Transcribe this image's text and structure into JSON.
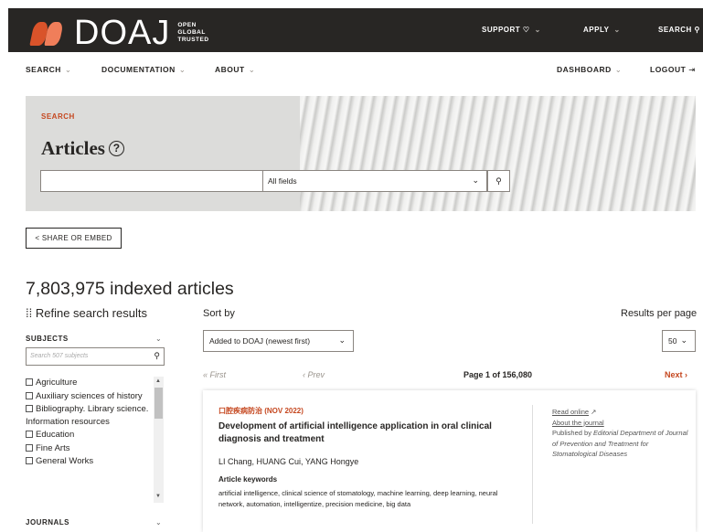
{
  "header": {
    "logo_text": "DOAJ",
    "tagline": [
      "OPEN",
      "GLOBAL",
      "TRUSTED"
    ],
    "support_label": "SUPPORT",
    "apply_label": "APPLY",
    "search_label": "SEARCH"
  },
  "subnav": {
    "search": "SEARCH",
    "documentation": "DOCUMENTATION",
    "about": "ABOUT",
    "dashboard": "DASHBOARD",
    "logout": "LOGOUT"
  },
  "hero": {
    "eyebrow": "SEARCH",
    "title": "Articles",
    "help_glyph": "?",
    "search_value": "",
    "field_select": "All fields",
    "search_button_glyph": "⚲"
  },
  "share_label": "SHARE OR EMBED",
  "results": {
    "count_text": "7,803,975 indexed articles",
    "refine_label": "Refine search results",
    "sort_by_label": "Sort by",
    "sort_value": "Added to DOAJ (newest first)",
    "per_page_label": "Results per page",
    "per_page_value": "50"
  },
  "sidebar": {
    "subjects_heading": "SUBJECTS",
    "subjects_placeholder": "Search 507 subjects",
    "subjects": [
      "Agriculture",
      "Auxiliary sciences of history",
      "Bibliography. Library science. Information resources",
      "Education",
      "Fine Arts",
      "General Works"
    ],
    "journals_heading": "JOURNALS"
  },
  "pager": {
    "first": "« First",
    "prev": "‹ Prev",
    "page_info": "Page 1 of 156,080",
    "next": "Next ›"
  },
  "article": {
    "journal_line": "口腔疾病防治 (NOV 2022)",
    "title": "Development of artificial intelligence application in oral clinical diagnosis and treatment",
    "authors": "LI Chang, HUANG Cui, YANG Hongye",
    "keywords_heading": "Article keywords",
    "keywords": "artificial intelligence, clinical science of stomatology, machine learning, deep learning, neural network, automation, intelligentize, precision medicine, big data",
    "read_online": "Read online",
    "about_journal": "About the journal",
    "published_by": "Published by",
    "publisher": "Editorial Department of Journal of Prevention and Treatment for Stomatological Diseases"
  },
  "colors": {
    "brand_dark": "#282624",
    "accent": "#c5471f"
  }
}
